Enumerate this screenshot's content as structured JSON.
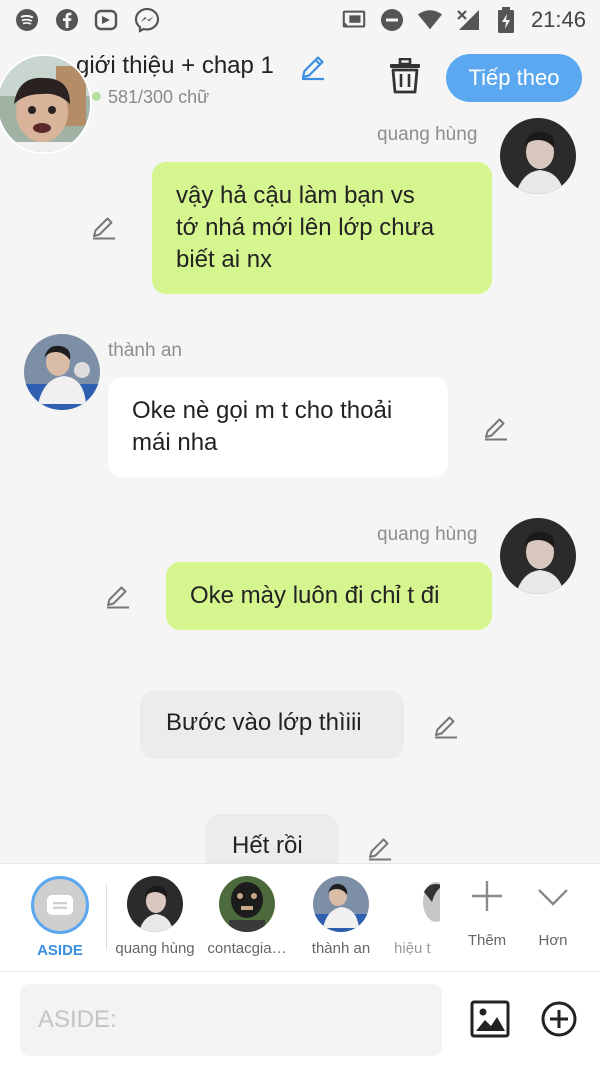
{
  "status_bar": {
    "time": "21:46",
    "icons": [
      "spotify-icon",
      "facebook-icon",
      "video-icon",
      "messenger-icon",
      "cast-icon",
      "dnd-icon",
      "wifi-icon",
      "no-signal-icon",
      "battery-charging-icon"
    ]
  },
  "header": {
    "title": "giới thiệu + chap 1",
    "word_count": "581/300 chữ",
    "next_label": "Tiếp theo"
  },
  "messages": [
    {
      "speaker": "quang hùng",
      "text_lines": [
        "vậy hả cậu làm bạn vs",
        "tớ nhá mới lên lớp chưa",
        "biết ai nx"
      ],
      "side": "right"
    },
    {
      "speaker": "thành an",
      "text_lines": [
        "Oke nè gọi m t cho thoải",
        "mái nha"
      ],
      "side": "left"
    },
    {
      "speaker": "quang hùng",
      "text_lines": [
        "Oke mày luôn đi chỉ t đi"
      ],
      "side": "right"
    },
    {
      "speaker": "",
      "text_lines": [
        "Bước vào lớp thìiii"
      ],
      "side": "center"
    },
    {
      "speaker": "",
      "text_lines": [
        "Hết rồi"
      ],
      "side": "center"
    }
  ],
  "characters": {
    "aside": "ASIDE",
    "c1": "quang hùng",
    "c2": "contacgia…",
    "c3": "thành an",
    "c4": "hiệu t",
    "more_label": "Thêm",
    "less_label": "Hơn"
  },
  "composer": {
    "placeholder": "ASIDE:"
  },
  "colors": {
    "accent": "#5ba8f0",
    "bubble_right": "#d5f58f",
    "bubble_left": "#ffffff",
    "bubble_aside": "#ececec"
  }
}
